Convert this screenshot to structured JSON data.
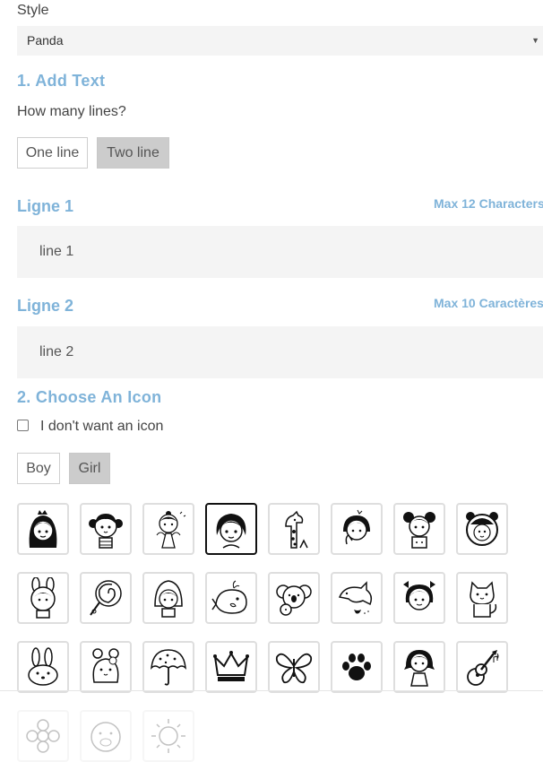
{
  "style": {
    "label": "Style",
    "selected": "Panda"
  },
  "section1": {
    "title": "1. Add Text",
    "question": "How many lines?",
    "options": [
      "One line",
      "Two line"
    ],
    "selected": "Two line"
  },
  "line1": {
    "title": "Ligne 1",
    "max": "Max 12 Characters",
    "value": "line 1"
  },
  "line2": {
    "title": "Ligne 2",
    "max": "Max 10 Caractères",
    "value": "line 2"
  },
  "section2": {
    "title": "2. Choose An Icon",
    "no_icon": "I don't want an icon",
    "tabs": [
      "Boy",
      "Girl"
    ],
    "selected_tab": "Girl"
  },
  "icons": {
    "row1": [
      "princess-icon",
      "girl-pigtails-icon",
      "fairy-girl-icon",
      "girl-bob-hair-icon",
      "giraffe-icon",
      "girl-thinking-icon",
      "girl-buns-icon",
      "bear-hood-kid-icon"
    ],
    "row2": [
      "bunny-hood-girl-icon",
      "lollipop-icon",
      "red-hood-girl-icon",
      "whale-icon",
      "koala-icon",
      "dolphin-icon",
      "girl-bows-icon",
      "cat-icon"
    ],
    "row3": [
      "bunny-icon",
      "bear-flower-icon",
      "umbrella-icon",
      "crown-icon",
      "butterfly-icon",
      "paw-icon",
      "girl-tails-icon",
      "guitar-icon"
    ],
    "row4": [
      "flower-icon",
      "pig-icon",
      "sun-icon"
    ],
    "selected": "girl-bob-hair-icon"
  }
}
